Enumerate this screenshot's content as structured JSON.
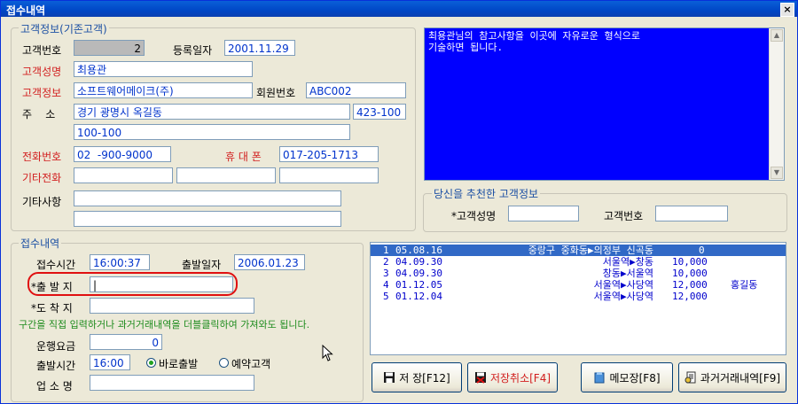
{
  "window": {
    "title": "접수내역",
    "close": "×"
  },
  "customer": {
    "legend": "고객정보(기존고객)",
    "id_label": "고객번호",
    "id_value": "2",
    "regdate_label": "등록일자",
    "regdate_value": "2001.11.29",
    "name_label": "고객성명",
    "name_value": "최용관",
    "info_label": "고객정보",
    "info_value": "소프트웨어메이크(주)",
    "member_label": "회원번호",
    "member_value": "ABC002",
    "addr_label": "주    소",
    "addr_value": "경기 광명시 옥길동",
    "zip_value": "423-100",
    "addr2_value": "100-100",
    "phone_label": "전화번호",
    "phone_value": "02  -900-9000",
    "mobile_label": "휴 대 폰",
    "mobile_value": "017-205-1713",
    "otherphone_label": "기타전화",
    "notes_label": "기타사항"
  },
  "memo": {
    "text": "최용관님의 참고사항을 이곳에 자유로운 형식으로\n기술하면 됩니다."
  },
  "referrer": {
    "legend": "당신을 추천한 고객정보",
    "name_label": "*고객성명",
    "id_label": "고객번호"
  },
  "reception": {
    "legend": "접수내역",
    "time_label": "접수시간",
    "time_value": "16:00:37",
    "depdate_label": "출발일자",
    "depdate_value": "2006.01.23",
    "origin_label": "*출 발 지",
    "dest_label": "*도 착 지",
    "hint": "구간을 직접 입력하거나 과거거래내역을 더블클릭하여 가져와도 됩니다.",
    "fare_label": "운행요금",
    "fare_value": "0",
    "deptime_label": "출발시간",
    "deptime_value": "16:00",
    "opt_now": "바로출발",
    "opt_reserve": "예약고객",
    "company_label": "업 소 명"
  },
  "history": {
    "rows": [
      {
        "no": "1",
        "date": "05.08.16",
        "route": "중랑구 중화동▶의정부 신곡동",
        "fare": "0",
        "name": ""
      },
      {
        "no": "2",
        "date": "04.09.30",
        "route": "서울역▶창동",
        "fare": "10,000",
        "name": ""
      },
      {
        "no": "3",
        "date": "04.09.30",
        "route": "창동▶서울역",
        "fare": "10,000",
        "name": ""
      },
      {
        "no": "4",
        "date": "01.12.05",
        "route": "서울역▶사당역",
        "fare": "12,000",
        "name": "홍길동"
      },
      {
        "no": "5",
        "date": "01.12.04",
        "route": "서울역▶사당역",
        "fare": "12,000",
        "name": ""
      }
    ]
  },
  "buttons": {
    "save": "저 장[F12]",
    "cancel": "저장취소[F4]",
    "memo": "메모장[F8]",
    "history": "과거거래내역[F9]"
  }
}
